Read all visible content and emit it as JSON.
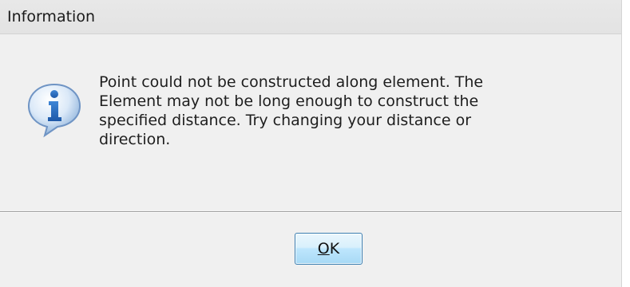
{
  "dialog": {
    "title": "Information",
    "icon": "information-icon",
    "message": "Point could not be constructed along element. The\nElement may not be long enough to construct the\nspecified distance. Try changing your distance or\ndirection.",
    "buttons": {
      "ok_label_mnemonic": "O",
      "ok_label_rest": "K"
    }
  },
  "colors": {
    "icon_blue": "#2b6fc4",
    "button_border": "#3c7fb1"
  }
}
